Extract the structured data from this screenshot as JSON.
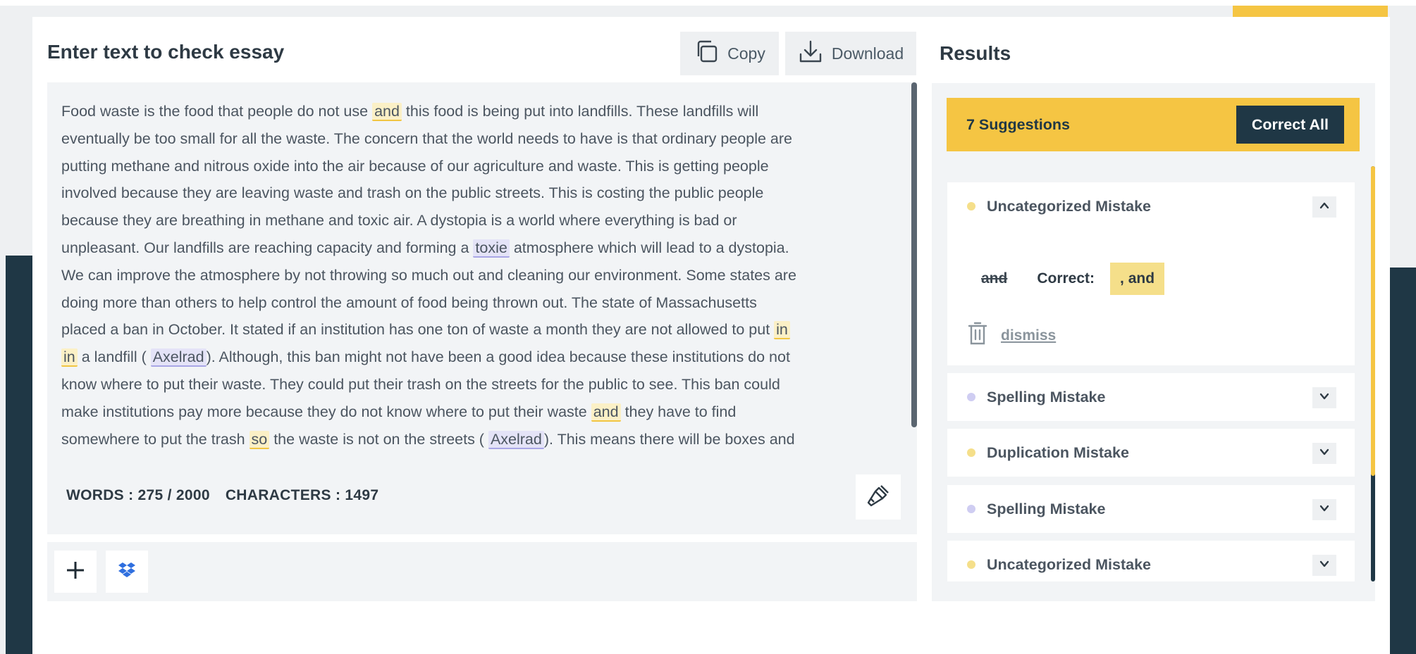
{
  "editor": {
    "title": "Enter text to check essay",
    "copy_label": "Copy",
    "download_label": "Download",
    "words_label": "WORDS : 275 / 2000",
    "characters_label": "CHARACTERS : 1497",
    "highlight_colors": {
      "duplication": "#f1c542",
      "spelling": "#a9a6e6"
    },
    "lines": [
      [
        {
          "t": "Food waste is the food that people do not use "
        },
        {
          "t": "and",
          "hl": "y"
        },
        {
          "t": " this food is being put into landfills. These landfills will"
        }
      ],
      [
        {
          "t": "eventually be too small for all the waste. The concern that the world needs to have is that ordinary people are"
        }
      ],
      [
        {
          "t": "putting methane and nitrous oxide into the air because of our agriculture and waste. This is getting people"
        }
      ],
      [
        {
          "t": "involved because they are leaving waste and trash on the public streets. This is costing the public people"
        }
      ],
      [
        {
          "t": "because they are breathing in methane and toxic air. A dystopia is a world where everything is bad or"
        }
      ],
      [
        {
          "t": "unpleasant. Our landfills are reaching capacity and forming a "
        },
        {
          "t": "toxie",
          "hl": "b"
        },
        {
          "t": " atmosphere which will lead to a dystopia."
        }
      ],
      [
        {
          "t": "We can improve the atmosphere by not throwing so much out and cleaning our environment. Some states are"
        }
      ],
      [
        {
          "t": "doing more than others to help control the amount of food being thrown out. The state of Massachusetts"
        }
      ],
      [
        {
          "t": "placed a ban in October. It stated if an institution has one ton of waste a month they are not allowed to put "
        },
        {
          "t": "in",
          "hl": "y"
        }
      ],
      [
        {
          "t": "in",
          "hl": "y"
        },
        {
          "t": " a landfill ( "
        },
        {
          "t": "Axelrad",
          "hl": "b"
        },
        {
          "t": "). Although, this ban might not have been a good idea because these institutions do not"
        }
      ],
      [
        {
          "t": "know where to put their waste. They could put their trash on the streets for the public to see. This ban could"
        }
      ],
      [
        {
          "t": "make institutions pay more because they do not know where to put their waste "
        },
        {
          "t": "and",
          "hl": "y"
        },
        {
          "t": " they have to find"
        }
      ],
      [
        {
          "t": "somewhere to put the trash "
        },
        {
          "t": "so",
          "hl": "y"
        },
        {
          "t": " the waste is not on the streets ( "
        },
        {
          "t": "Axelrad",
          "hl": "b"
        },
        {
          "t": "). This means there will be boxes and"
        }
      ]
    ]
  },
  "results": {
    "title": "Results",
    "suggestions_label": "7 Suggestions",
    "correct_all_label": "Correct All",
    "expanded": {
      "title": "Uncategorized Mistake",
      "original": "and",
      "correct_label": "Correct:",
      "correct_value": ", and",
      "dismiss_label": "dismiss"
    },
    "mistakes": [
      {
        "title": "Spelling Mistake",
        "dot": "b"
      },
      {
        "title": "Duplication Mistake",
        "dot": "y"
      },
      {
        "title": "Spelling Mistake",
        "dot": "b"
      },
      {
        "title": "Uncategorized Mistake",
        "dot": "y"
      }
    ]
  },
  "colors": {
    "accent_yellow": "#f5c543",
    "dark_navy": "#1f3745"
  }
}
